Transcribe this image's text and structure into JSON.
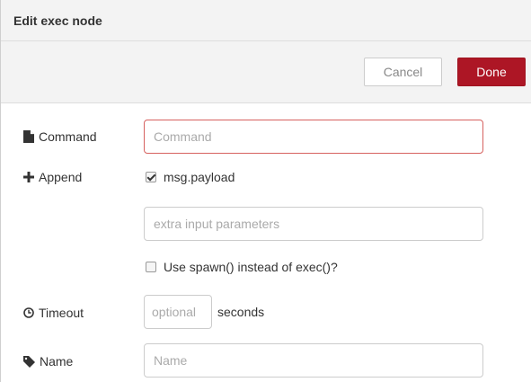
{
  "tray": {
    "title": "Edit exec node"
  },
  "toolbar": {
    "cancel_label": "Cancel",
    "done_label": "Done"
  },
  "form": {
    "command": {
      "label": "Command",
      "icon": "file-icon",
      "placeholder": "Command",
      "value": ""
    },
    "append": {
      "label": "Append",
      "icon": "plus-icon",
      "checkbox_label": "msg.payload",
      "checked": true,
      "extra_placeholder": "extra input parameters"
    },
    "spawn": {
      "checkbox_label": "Use spawn() instead of exec()?",
      "checked": false
    },
    "timeout": {
      "label": "Timeout",
      "icon": "clock-icon",
      "placeholder": "optional",
      "unit": "seconds"
    },
    "name": {
      "label": "Name",
      "icon": "tag-icon",
      "placeholder": "Name"
    }
  },
  "colors": {
    "done_button": "#ad1625",
    "invalid_border": "#d6615f",
    "header_bg": "#f3f3f3"
  }
}
